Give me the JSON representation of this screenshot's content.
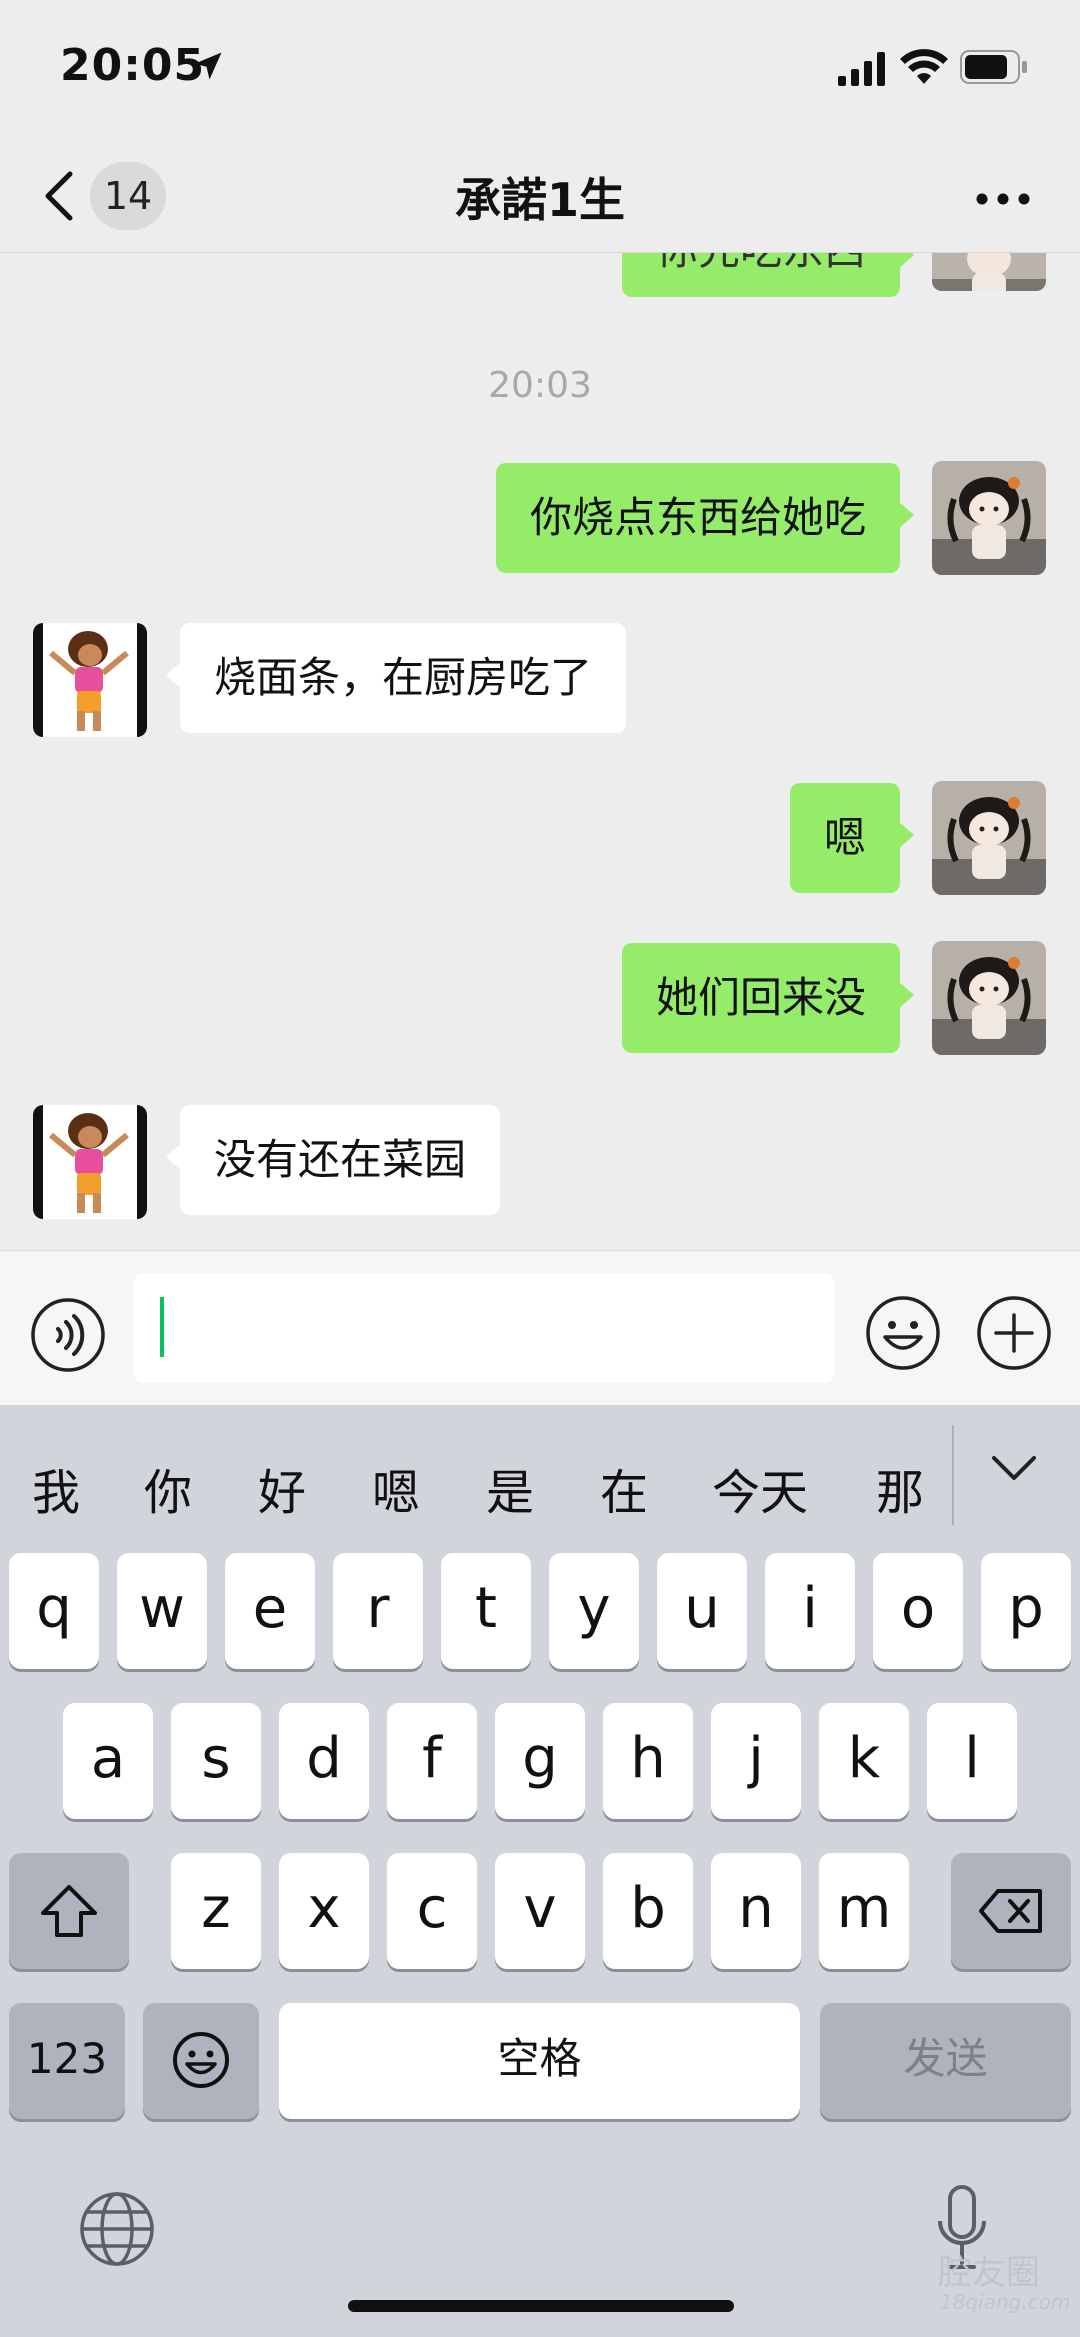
{
  "status_bar": {
    "time": "20:05"
  },
  "nav": {
    "back_badge": "14",
    "title": "承諾1生"
  },
  "chat": {
    "timestamp": "20:03",
    "partial_message": "你先吃东西",
    "messages": [
      {
        "side": "right",
        "text": "你烧点东西给她吃"
      },
      {
        "side": "left",
        "text": "烧面条，在厨房吃了"
      },
      {
        "side": "right",
        "text": "嗯"
      },
      {
        "side": "right",
        "text": "她们回来没"
      },
      {
        "side": "left",
        "text": "没有还在菜园"
      }
    ]
  },
  "input": {
    "value": ""
  },
  "keyboard": {
    "candidates": [
      "我",
      "你",
      "好",
      "嗯",
      "是",
      "在",
      "今天",
      "那"
    ],
    "row1": [
      "q",
      "w",
      "e",
      "r",
      "t",
      "y",
      "u",
      "i",
      "o",
      "p"
    ],
    "row2": [
      "a",
      "s",
      "d",
      "f",
      "g",
      "h",
      "j",
      "k",
      "l"
    ],
    "row3": [
      "z",
      "x",
      "c",
      "v",
      "b",
      "n",
      "m"
    ],
    "num_label": "123",
    "space_label": "空格",
    "send_label": "发送"
  },
  "watermark": {
    "text": "腔友圈",
    "sub": "18qiang.com"
  },
  "colors": {
    "bubble_right": "#95ec69",
    "bubble_left": "#ffffff",
    "accent": "#07c160",
    "keyboard_bg": "#d1d4db"
  }
}
